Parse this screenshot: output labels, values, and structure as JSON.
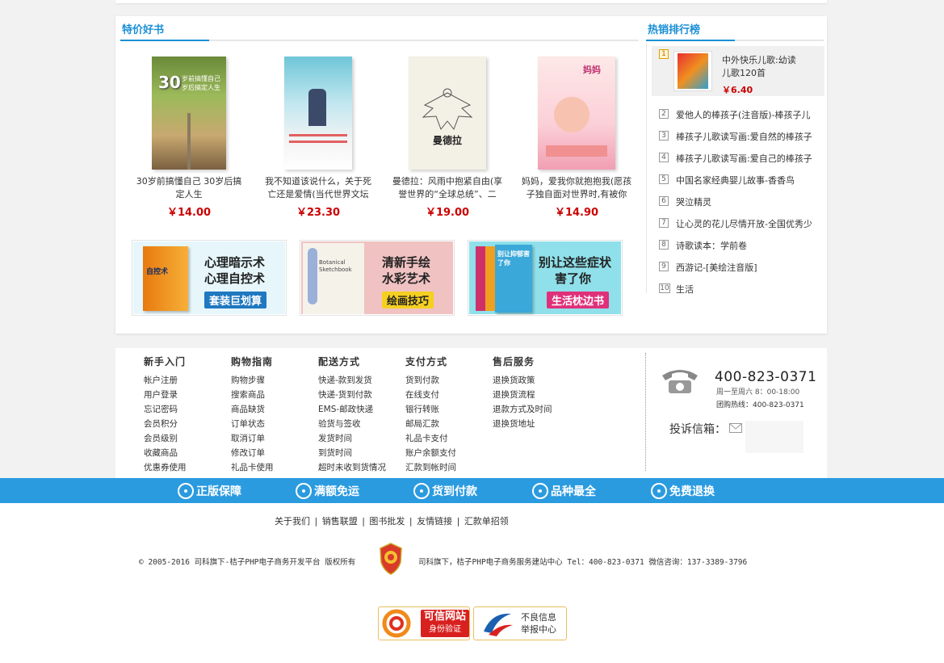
{
  "section_title": "特价好书",
  "books": [
    {
      "title": "30岁前搞懂自己 30岁后搞定人生",
      "price": "￥14.00",
      "cover_text": "30岁前搞懂自己\n岁后搞定人生"
    },
    {
      "title": "我不知道该说什么，关于死亡还是爱情(当代世界文坛",
      "price": "￥23.30",
      "cover_text": ""
    },
    {
      "title": "曼德拉：风雨中抱紧自由(享誉世界的“全球总统”、二",
      "price": "￥19.00",
      "cover_text": "曼德拉"
    },
    {
      "title": "妈妈，爱我你就抱抱我(愿孩子独自面对世界时,有被你",
      "price": "￥14.90",
      "cover_text": "妈妈"
    }
  ],
  "banners": [
    {
      "line1": "心理暗示术",
      "line2": "心理自控术",
      "tag": "套装巨划算",
      "book_text": "自控术"
    },
    {
      "line1": "清新手绘",
      "line2": "水彩艺术",
      "tag": "绘画技巧",
      "book_text": "Botanical Sketchbook"
    },
    {
      "line1": "别让这些症状",
      "line2": "害了你",
      "tag": "生活枕边书",
      "book_text": "别让抑郁害了你"
    }
  ],
  "hot": {
    "title": "热销排行榜",
    "first": {
      "num": "1",
      "title": "中外快乐儿歌:幼读儿歌120首",
      "price": "￥6.40"
    },
    "items": [
      {
        "num": "2",
        "title": "爱他人的棒孩子(注音版)-棒孩子儿"
      },
      {
        "num": "3",
        "title": "棒孩子儿歌读写画:爱自然的棒孩子"
      },
      {
        "num": "4",
        "title": "棒孩子儿歌读写画:爱自己的棒孩子"
      },
      {
        "num": "5",
        "title": "中国名家经典婴儿故事-香香鸟"
      },
      {
        "num": "6",
        "title": "哭泣精灵"
      },
      {
        "num": "7",
        "title": "让心灵的花儿尽情开放-全国优秀少"
      },
      {
        "num": "8",
        "title": "诗歌读本：学前卷"
      },
      {
        "num": "9",
        "title": "西游记-[美绘注音版]"
      },
      {
        "num": "10",
        "title": "生活"
      }
    ]
  },
  "footer_cols": [
    {
      "head": "新手入门",
      "items": [
        "帐户注册",
        "用户登录",
        "忘记密码",
        "会员积分",
        "会员级别",
        "收藏商品",
        "优惠券使用"
      ]
    },
    {
      "head": "购物指南",
      "items": [
        "购物步骤",
        "搜索商品",
        "商品缺货",
        "订单状态",
        "取消订单",
        "修改订单",
        "礼品卡使用"
      ]
    },
    {
      "head": "配送方式",
      "items": [
        "快递-款到发货",
        "快递-货到付款",
        "EMS-邮政快递",
        "验货与签收",
        "发货时间",
        "到货时间",
        "超时未收到货情况"
      ]
    },
    {
      "head": "支付方式",
      "items": [
        "货到付款",
        "在线支付",
        "银行转账",
        "邮局汇款",
        "礼品卡支付",
        "账户余额支付",
        "汇款到帐时间"
      ]
    },
    {
      "head": "售后服务",
      "items": [
        "退换货政策",
        "退换货流程",
        "退款方式及时间",
        "退换货地址"
      ]
    }
  ],
  "contact": {
    "phone": "400-823-0371",
    "hours": "周一至周六 8：00-18:00",
    "group": "团购热线：400-823-0371",
    "complain": "投诉信箱："
  },
  "bluebar": [
    "正版保障",
    "满额免运",
    "货到付款",
    "品种最全",
    "免费退换"
  ],
  "links": [
    "关于我们",
    "销售联盟",
    "图书批发",
    "友情链接",
    "汇款单招领"
  ],
  "copyright_left": "© 2005-2016 司科旗下-桔子PHP电子商务开发平台 版权所有",
  "copyright_right": "司科旗下，桔子PHP电子商务服务建站中心  Tel：400-823-0371   微信咨询：137-3389-3796",
  "trust": {
    "badge1_title": "可信网站",
    "badge1_sub": "身份验证",
    "badge2_line1": "不良信息",
    "badge2_line2": "举报中心"
  },
  "colors": {
    "accent": "#1a8fd6",
    "price": "#cc0000",
    "bar": "#2b9be0"
  }
}
